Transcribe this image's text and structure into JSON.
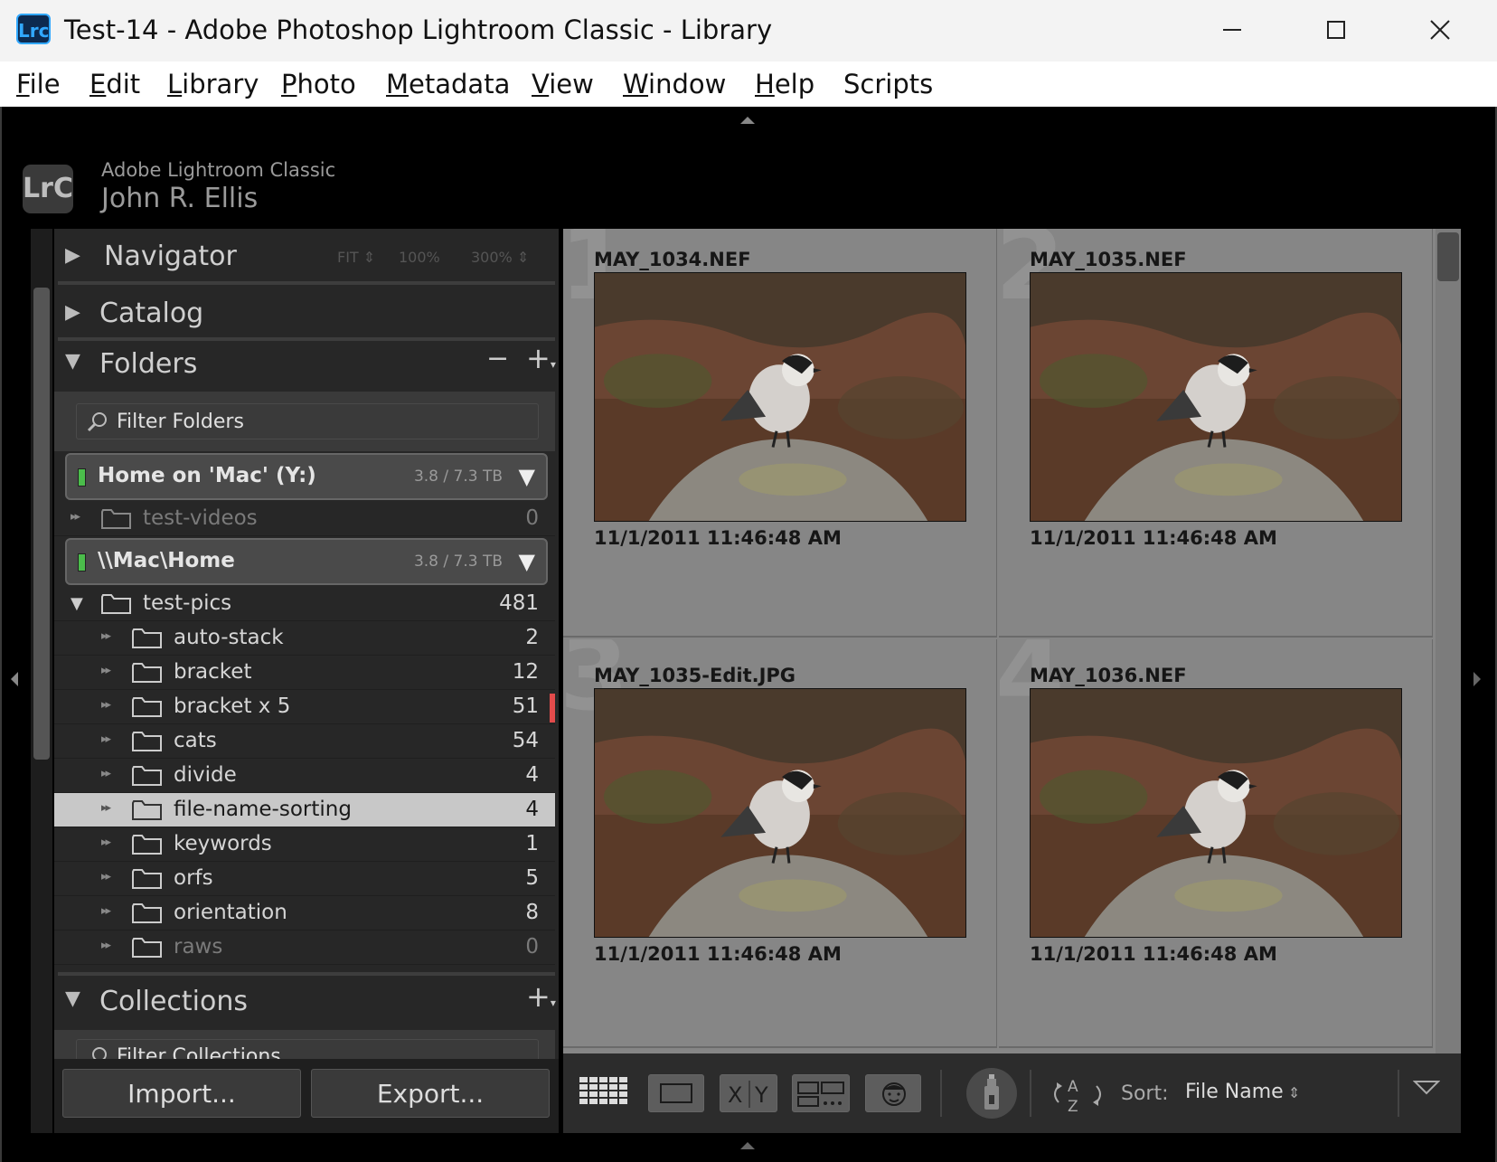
{
  "window": {
    "app_icon": "Lrc",
    "title": "Test-14 - Adobe Photoshop Lightroom Classic - Library"
  },
  "menu": [
    {
      "key": "F",
      "rest": "ile"
    },
    {
      "key": "E",
      "rest": "dit"
    },
    {
      "key": "L",
      "rest": "ibrary"
    },
    {
      "key": "P",
      "rest": "hoto"
    },
    {
      "key": "M",
      "rest": "etadata"
    },
    {
      "key": "V",
      "rest": "iew"
    },
    {
      "key": "W",
      "rest": "indow"
    },
    {
      "key": "H",
      "rest": "elp"
    },
    {
      "key": "",
      "rest": "Scripts"
    }
  ],
  "identity": {
    "logo": "LrC",
    "app_name": "Adobe Lightroom Classic",
    "user_name": "John R. Ellis"
  },
  "left_panel": {
    "navigator": {
      "title": "Navigator",
      "fit": "FIT",
      "zoom1": "100%",
      "zoom2": "300%"
    },
    "catalog": {
      "title": "Catalog"
    },
    "folders": {
      "title": "Folders",
      "minus": "−",
      "plus": "+",
      "filter_placeholder": "Filter Folders",
      "volume1": {
        "name": "Home on 'Mac' (Y:)",
        "size": "3.8 / 7.3 TB"
      },
      "volume1_folder": {
        "name": "test-videos",
        "count": "0"
      },
      "volume2": {
        "name": "\\\\Mac\\Home",
        "size": "3.8 / 7.3 TB"
      },
      "root": {
        "name": "test-pics",
        "count": "481"
      },
      "subfolders": [
        {
          "name": "auto-stack",
          "count": "2"
        },
        {
          "name": "bracket",
          "count": "12"
        },
        {
          "name": "bracket x 5",
          "count": "51"
        },
        {
          "name": "cats",
          "count": "54"
        },
        {
          "name": "divide",
          "count": "4"
        },
        {
          "name": "file-name-sorting",
          "count": "4"
        },
        {
          "name": "keywords",
          "count": "1"
        },
        {
          "name": "orfs",
          "count": "5"
        },
        {
          "name": "orientation",
          "count": "8"
        },
        {
          "name": "raws",
          "count": "0"
        }
      ]
    },
    "collections": {
      "title": "Collections",
      "plus": "+",
      "filter_placeholder": "Filter Collections"
    },
    "import_label": "Import...",
    "export_label": "Export..."
  },
  "grid": [
    {
      "index": "1",
      "filename": "MAY_1034.NEF",
      "date": "11/1/2011 11:46:48 AM"
    },
    {
      "index": "2",
      "filename": "MAY_1035.NEF",
      "date": "11/1/2011 11:46:48 AM"
    },
    {
      "index": "3",
      "filename": "MAY_1035-Edit.JPG",
      "date": "11/1/2011 11:46:48 AM"
    },
    {
      "index": "4",
      "filename": "MAY_1036.NEF",
      "date": "11/1/2011 11:46:48 AM"
    }
  ],
  "toolbar": {
    "sort_label": "Sort:",
    "sort_value": "File Name"
  },
  "colors": {
    "panel": "#272727",
    "grid_bg": "#868686",
    "selected_row": "#c8c8c8",
    "label_red": "#e24b4b",
    "volume_led": "#4bbd4b"
  }
}
